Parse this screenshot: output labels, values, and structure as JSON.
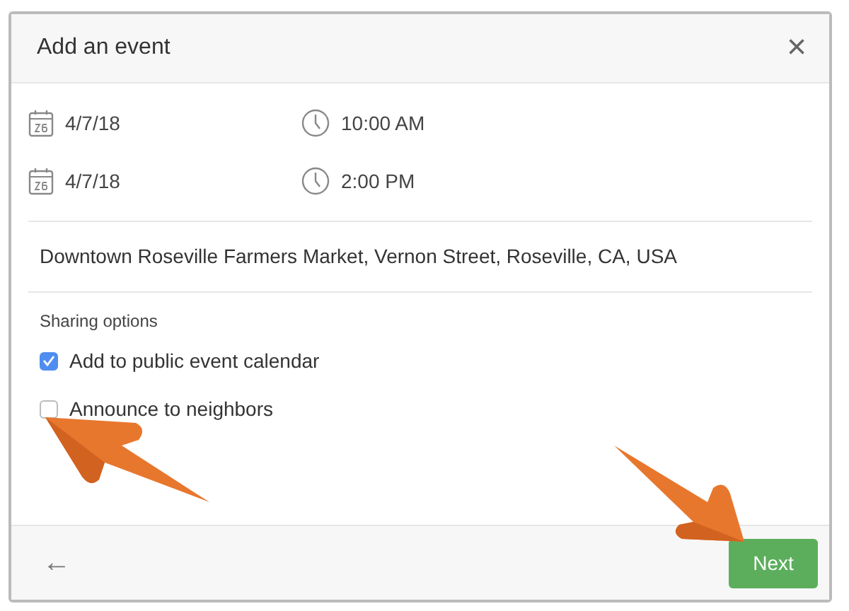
{
  "dialog": {
    "title": "Add an event",
    "close": "×"
  },
  "schedule": [
    {
      "date": "4/7/18",
      "time": "10:00 AM"
    },
    {
      "date": "4/7/18",
      "time": "2:00 PM"
    }
  ],
  "location": "Downtown Roseville Farmers Market, Vernon Street, Roseville, CA, USA",
  "sharing": {
    "heading": "Sharing options",
    "options": [
      {
        "label": "Add to public event calendar",
        "checked": true
      },
      {
        "label": "Announce to neighbors",
        "checked": false
      }
    ]
  },
  "footer": {
    "back": "←",
    "next": "Next"
  }
}
